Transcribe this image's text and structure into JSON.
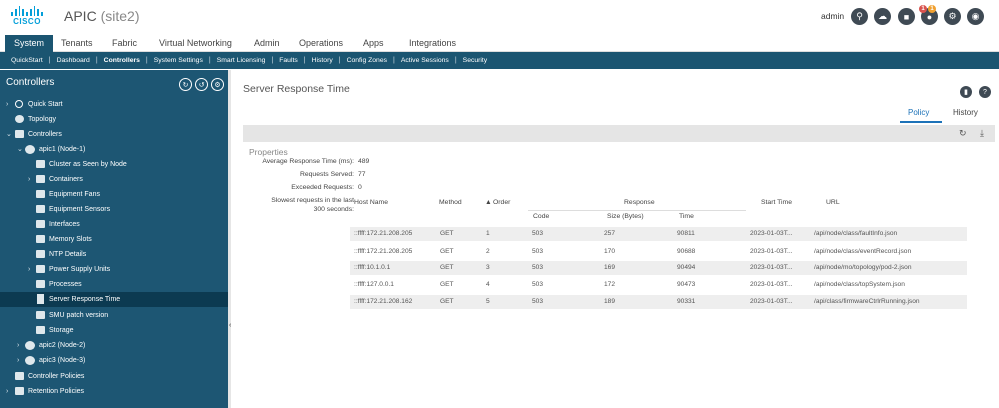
{
  "header": {
    "logo_text": "CISCO",
    "app_name": "APIC",
    "site": "(site2)",
    "user": "admin",
    "alert_badges": [
      "1",
      "1"
    ]
  },
  "main_tabs": [
    "System",
    "Tenants",
    "Fabric",
    "Virtual Networking",
    "Admin",
    "Operations",
    "Apps",
    "Integrations"
  ],
  "sub_tabs": [
    "QuickStart",
    "Dashboard",
    "Controllers",
    "System Settings",
    "Smart Licensing",
    "Faults",
    "History",
    "Config Zones",
    "Active Sessions",
    "Security"
  ],
  "sidebar": {
    "title": "Controllers",
    "items": [
      {
        "label": "Quick Start"
      },
      {
        "label": "Topology"
      },
      {
        "label": "Controllers"
      },
      {
        "label": "apic1 (Node-1)"
      },
      {
        "label": "Cluster as Seen by Node"
      },
      {
        "label": "Containers"
      },
      {
        "label": "Equipment Fans"
      },
      {
        "label": "Equipment Sensors"
      },
      {
        "label": "Interfaces"
      },
      {
        "label": "Memory Slots"
      },
      {
        "label": "NTP Details"
      },
      {
        "label": "Power Supply Units"
      },
      {
        "label": "Processes"
      },
      {
        "label": "Server Response Time"
      },
      {
        "label": "SMU patch version"
      },
      {
        "label": "Storage"
      },
      {
        "label": "apic2 (Node-2)"
      },
      {
        "label": "apic3 (Node-3)"
      },
      {
        "label": "Controller Policies"
      },
      {
        "label": "Retention Policies"
      }
    ]
  },
  "content": {
    "title": "Server Response Time",
    "tabs": [
      "Policy",
      "History"
    ],
    "properties_title": "Properties",
    "props": [
      {
        "label": "Average Response Time (ms):",
        "value": "489"
      },
      {
        "label": "Requests Served:",
        "value": "77"
      },
      {
        "label": "Exceeded Requests:",
        "value": "0"
      }
    ],
    "slowest_label_1": "Slowest requests in the last",
    "slowest_label_2": "300 seconds:",
    "table": {
      "headers": {
        "host": "Host Name",
        "method": "Method",
        "order": "Order",
        "response": "Response",
        "code": "Code",
        "size": "Size (Bytes)",
        "time": "Time",
        "start": "Start Time",
        "url": "URL"
      },
      "rows": [
        {
          "host": "::ffff:172.21.208.205",
          "method": "GET",
          "order": "1",
          "code": "503",
          "size": "257",
          "time": "90811",
          "start": "2023-01-03T...",
          "url": "/api/node/class/faultInfo.json"
        },
        {
          "host": "::ffff:172.21.208.205",
          "method": "GET",
          "order": "2",
          "code": "503",
          "size": "170",
          "time": "90688",
          "start": "2023-01-03T...",
          "url": "/api/node/class/eventRecord.json"
        },
        {
          "host": "::ffff:10.1.0.1",
          "method": "GET",
          "order": "3",
          "code": "503",
          "size": "169",
          "time": "90494",
          "start": "2023-01-03T...",
          "url": "/api/node/mo/topology/pod-2.json"
        },
        {
          "host": "::ffff:127.0.0.1",
          "method": "GET",
          "order": "4",
          "code": "503",
          "size": "172",
          "time": "90473",
          "start": "2023-01-03T...",
          "url": "/api/node/class/topSystem.json"
        },
        {
          "host": "::ffff:172.21.208.162",
          "method": "GET",
          "order": "5",
          "code": "503",
          "size": "189",
          "time": "90331",
          "start": "2023-01-03T...",
          "url": "/api/class/firmwareCtrlrRunning.json"
        }
      ]
    }
  }
}
